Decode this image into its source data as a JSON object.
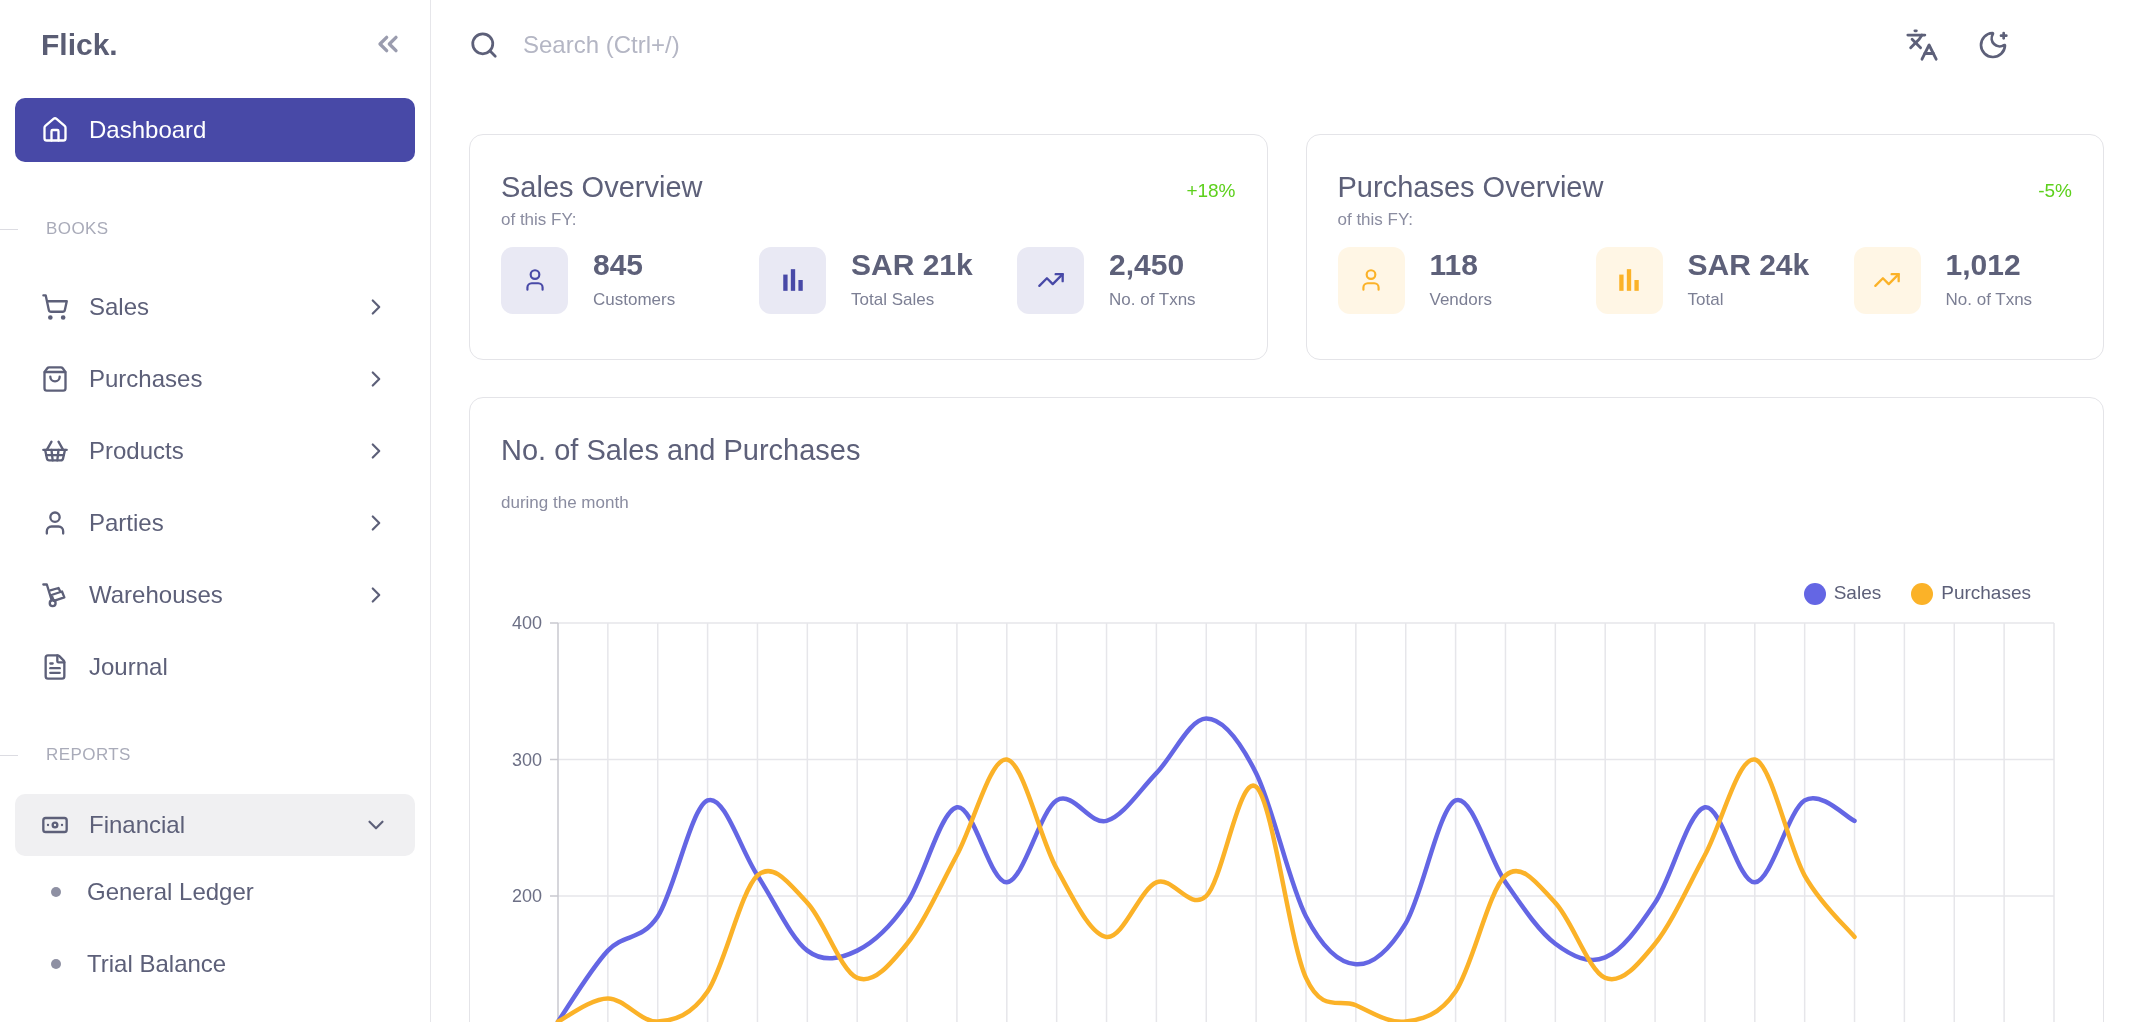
{
  "sidebar": {
    "logo": "Flick.",
    "top_item": {
      "label": "Dashboard",
      "selected": true
    },
    "sections": [
      {
        "title": "BOOKS",
        "items": [
          {
            "label": "Sales",
            "selected": false,
            "has_submenu": true,
            "expanded": false
          },
          {
            "label": "Purchases",
            "selected": false,
            "has_submenu": true,
            "expanded": false
          },
          {
            "label": "Products",
            "selected": false,
            "has_submenu": true,
            "expanded": false
          },
          {
            "label": "Parties",
            "selected": false,
            "has_submenu": true,
            "expanded": false
          },
          {
            "label": "Warehouses",
            "selected": false,
            "has_submenu": true,
            "expanded": false
          },
          {
            "label": "Journal",
            "selected": false,
            "has_submenu": false,
            "expanded": false
          }
        ]
      },
      {
        "title": "REPORTS",
        "items": [
          {
            "label": "Financial",
            "selected": false,
            "has_submenu": true,
            "expanded": true,
            "children": [
              {
                "label": "General Ledger",
                "selected": false
              },
              {
                "label": "Trial Balance",
                "selected": false
              }
            ]
          }
        ]
      }
    ]
  },
  "header": {
    "search": {
      "placeholder": "Search (Ctrl+/)"
    }
  },
  "overview_cards": [
    {
      "title": "Sales Overview",
      "subtitle": "of this FY:",
      "change": "+18%",
      "color": "#4849a7",
      "stats": [
        {
          "value": "845",
          "label": "Customers"
        },
        {
          "value": "SAR 21k",
          "label": "Total Sales"
        },
        {
          "value": "2,450",
          "label": "No. of Txns"
        }
      ]
    },
    {
      "title": "Purchases Overview",
      "subtitle": "of this FY:",
      "change": "-5%",
      "color": "#fbb228",
      "stats": [
        {
          "value": "118",
          "label": "Vendors"
        },
        {
          "value": "SAR 24k",
          "label": "Total"
        },
        {
          "value": "1,012",
          "label": "No. of Txns"
        }
      ]
    }
  ],
  "chart_card": {
    "title": "No. of Sales and Purchases",
    "subtitle": "during the month",
    "chart_data": {
      "type": "line",
      "categories": [
        null,
        null,
        null,
        null,
        null,
        null,
        null,
        null,
        null,
        null,
        null,
        null,
        null,
        null,
        null,
        null,
        null,
        null,
        null,
        null,
        null,
        null,
        null,
        null,
        null,
        null,
        null,
        null,
        null,
        null,
        null
      ],
      "ylim": [
        0,
        400
      ],
      "yticks": [
        200,
        300,
        400
      ],
      "grid": true,
      "legend": true,
      "series": [
        {
          "name": "Sales",
          "color": "#6466e4",
          "values": [
            108,
            160,
            185,
            270,
            215,
            160,
            160,
            195,
            265,
            210,
            270,
            255,
            290,
            330,
            290,
            185,
            150,
            180,
            270,
            210,
            165,
            155,
            195,
            265,
            210,
            270,
            255,
            null,
            null,
            null,
            null
          ]
        },
        {
          "name": "Purchases",
          "color": "#fbb228",
          "values": [
            108,
            125,
            108,
            130,
            215,
            195,
            140,
            165,
            230,
            300,
            220,
            170,
            210,
            200,
            280,
            140,
            120,
            108,
            130,
            215,
            195,
            140,
            165,
            230,
            300,
            215,
            170,
            null,
            null,
            null,
            null
          ]
        }
      ]
    }
  }
}
